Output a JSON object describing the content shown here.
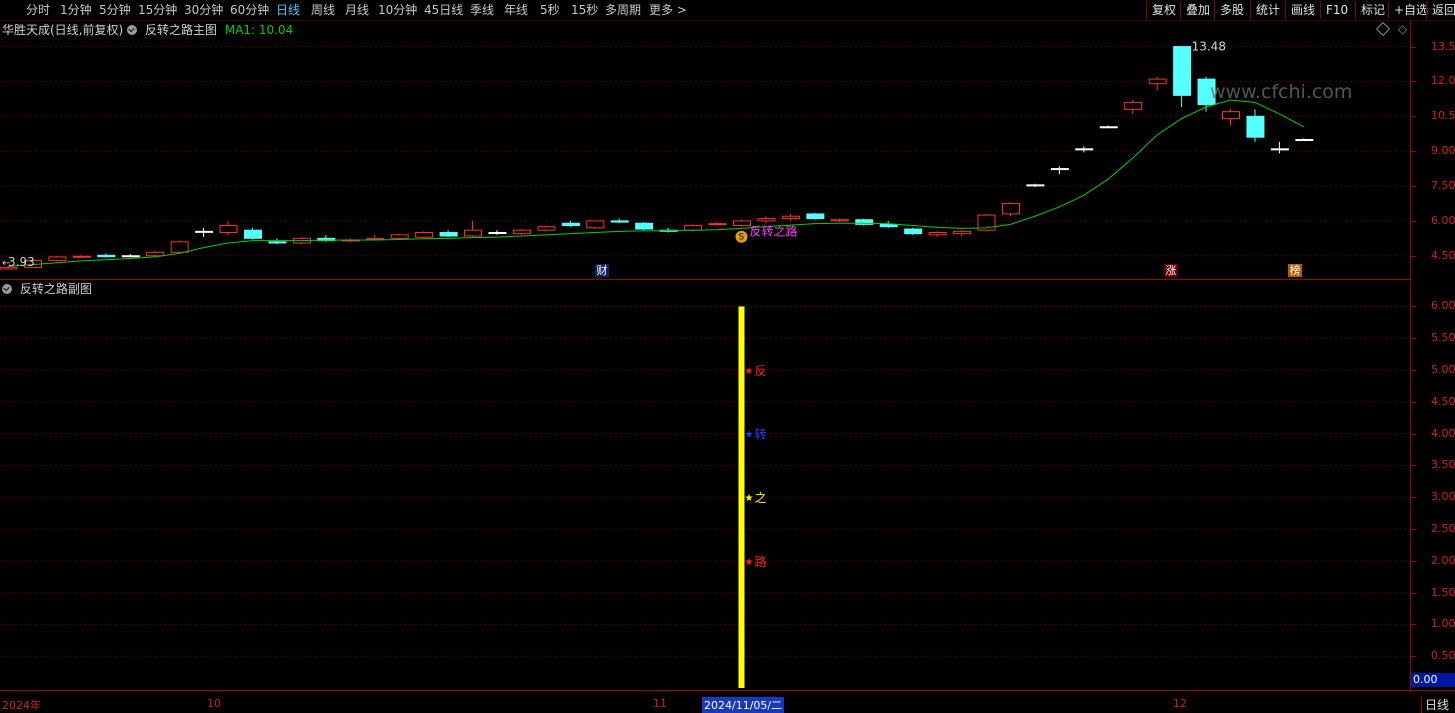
{
  "toolbar": {
    "periods": [
      "分时",
      "1分钟",
      "5分钟",
      "15分钟",
      "30分钟",
      "60分钟",
      "日线",
      "周线",
      "月线",
      "10分钟",
      "45日线",
      "季线",
      "年线",
      "5秒",
      "15秒",
      "多周期",
      "更多 >"
    ],
    "active_period": "日线",
    "tools": [
      "复权",
      "叠加",
      "多股",
      "统计",
      "画线",
      "F10",
      "标记",
      "+自选",
      "返回"
    ]
  },
  "main_chart": {
    "stock_title": "华胜天成(日线,前复权)",
    "indicator_name": "反转之路主图",
    "ma_label": "MA1: 10.04",
    "high_label": "13.48",
    "low_label": "3.93",
    "signal_label": "反转之路",
    "signal_marker": "S",
    "watermark": "www.cfchi.com",
    "y_ticks": [
      "13.50",
      "12.00",
      "10.50",
      "9.00",
      "7.50",
      "6.00",
      "4.50"
    ],
    "event_badges": [
      "财",
      "涨",
      "榜"
    ]
  },
  "sub_chart": {
    "indicator_name": "反转之路副图",
    "y_ticks": [
      "6.00",
      "5.50",
      "5.00",
      "4.50",
      "4.00",
      "3.50",
      "3.00",
      "2.50",
      "2.00",
      "1.50",
      "1.00",
      "0.50"
    ],
    "stars": [
      {
        "char": "反",
        "color": "#ff2020"
      },
      {
        "char": "转",
        "color": "#2040ff"
      },
      {
        "char": "之",
        "color": "#ffff00"
      },
      {
        "char": "路",
        "color": "#ff2020"
      }
    ],
    "readout": "0.00"
  },
  "x_axis": {
    "labels": [
      "2024年",
      "10",
      "11",
      "2024/11/05/二",
      "12"
    ],
    "period_button": "日线"
  },
  "colors": {
    "up": "#ff3030",
    "down": "#54ffff",
    "ma": "#00d000",
    "grid": "#5a0000",
    "axis": "#a00000",
    "bar": "#ffff00"
  },
  "chart_data": {
    "type": "candlestick",
    "ma_series": "MA1",
    "candles": [
      {
        "o": 3.93,
        "h": 4.05,
        "l": 3.93,
        "c": 4.0
      },
      {
        "o": 4.0,
        "h": 4.35,
        "l": 3.98,
        "c": 4.3
      },
      {
        "o": 4.3,
        "h": 4.5,
        "l": 4.25,
        "c": 4.45
      },
      {
        "o": 4.45,
        "h": 4.52,
        "l": 4.4,
        "c": 4.48
      },
      {
        "o": 4.52,
        "h": 4.6,
        "l": 4.42,
        "c": 4.46
      },
      {
        "o": 4.48,
        "h": 4.58,
        "l": 4.45,
        "c": 4.5
      },
      {
        "o": 4.5,
        "h": 4.7,
        "l": 4.48,
        "c": 4.65
      },
      {
        "o": 4.65,
        "h": 5.15,
        "l": 4.62,
        "c": 5.1
      },
      {
        "o": 5.55,
        "h": 5.7,
        "l": 5.3,
        "c": 5.55
      },
      {
        "o": 5.5,
        "h": 6.0,
        "l": 5.4,
        "c": 5.8
      },
      {
        "o": 5.6,
        "h": 5.7,
        "l": 5.2,
        "c": 5.25
      },
      {
        "o": 5.1,
        "h": 5.25,
        "l": 5.0,
        "c": 5.05
      },
      {
        "o": 5.05,
        "h": 5.3,
        "l": 5.0,
        "c": 5.25
      },
      {
        "o": 5.25,
        "h": 5.4,
        "l": 5.1,
        "c": 5.15
      },
      {
        "o": 5.15,
        "h": 5.25,
        "l": 5.08,
        "c": 5.18
      },
      {
        "o": 5.2,
        "h": 5.4,
        "l": 5.15,
        "c": 5.25
      },
      {
        "o": 5.25,
        "h": 5.45,
        "l": 5.2,
        "c": 5.4
      },
      {
        "o": 5.3,
        "h": 5.55,
        "l": 5.25,
        "c": 5.5
      },
      {
        "o": 5.5,
        "h": 5.6,
        "l": 5.3,
        "c": 5.35
      },
      {
        "o": 5.35,
        "h": 6.0,
        "l": 5.3,
        "c": 5.6
      },
      {
        "o": 5.5,
        "h": 5.6,
        "l": 5.4,
        "c": 5.5
      },
      {
        "o": 5.45,
        "h": 5.65,
        "l": 5.4,
        "c": 5.6
      },
      {
        "o": 5.6,
        "h": 5.8,
        "l": 5.55,
        "c": 5.75
      },
      {
        "o": 5.9,
        "h": 6.0,
        "l": 5.75,
        "c": 5.8
      },
      {
        "o": 5.7,
        "h": 6.0,
        "l": 5.65,
        "c": 6.0
      },
      {
        "o": 6.0,
        "h": 6.1,
        "l": 5.9,
        "c": 5.95
      },
      {
        "o": 5.9,
        "h": 5.95,
        "l": 5.6,
        "c": 5.65
      },
      {
        "o": 5.6,
        "h": 5.7,
        "l": 5.5,
        "c": 5.55
      },
      {
        "o": 5.6,
        "h": 5.85,
        "l": 5.55,
        "c": 5.8
      },
      {
        "o": 5.85,
        "h": 5.95,
        "l": 5.8,
        "c": 5.88
      },
      {
        "o": 5.8,
        "h": 6.05,
        "l": 5.75,
        "c": 6.0
      },
      {
        "o": 6.0,
        "h": 6.2,
        "l": 5.9,
        "c": 6.1
      },
      {
        "o": 6.1,
        "h": 6.3,
        "l": 6.0,
        "c": 6.2
      },
      {
        "o": 6.3,
        "h": 6.35,
        "l": 6.05,
        "c": 6.1
      },
      {
        "o": 6.0,
        "h": 6.1,
        "l": 5.95,
        "c": 6.05
      },
      {
        "o": 6.05,
        "h": 6.1,
        "l": 5.8,
        "c": 5.85
      },
      {
        "o": 5.85,
        "h": 6.0,
        "l": 5.7,
        "c": 5.75
      },
      {
        "o": 5.65,
        "h": 5.7,
        "l": 5.4,
        "c": 5.45
      },
      {
        "o": 5.4,
        "h": 5.55,
        "l": 5.3,
        "c": 5.5
      },
      {
        "o": 5.45,
        "h": 5.6,
        "l": 5.35,
        "c": 5.55
      },
      {
        "o": 5.6,
        "h": 6.3,
        "l": 5.55,
        "c": 6.25
      },
      {
        "o": 6.3,
        "h": 6.8,
        "l": 6.2,
        "c": 6.75
      },
      {
        "o": 7.55,
        "h": 7.6,
        "l": 7.45,
        "c": 7.55
      },
      {
        "o": 8.25,
        "h": 8.35,
        "l": 8.0,
        "c": 8.25
      },
      {
        "o": 9.1,
        "h": 9.2,
        "l": 8.95,
        "c": 9.1
      },
      {
        "o": 10.05,
        "h": 10.1,
        "l": 10.0,
        "c": 10.05
      },
      {
        "o": 10.8,
        "h": 11.2,
        "l": 10.6,
        "c": 11.1
      },
      {
        "o": 11.9,
        "h": 12.2,
        "l": 11.6,
        "c": 12.1
      },
      {
        "o": 13.5,
        "h": 13.5,
        "l": 10.9,
        "c": 11.4
      },
      {
        "o": 12.1,
        "h": 12.2,
        "l": 10.7,
        "c": 11.0
      },
      {
        "o": 10.4,
        "h": 10.8,
        "l": 10.1,
        "c": 10.7
      },
      {
        "o": 10.5,
        "h": 10.8,
        "l": 9.4,
        "c": 9.6
      },
      {
        "o": 9.1,
        "h": 9.4,
        "l": 8.9,
        "c": 9.1
      },
      {
        "o": 9.5,
        "h": 9.55,
        "l": 9.45,
        "c": 9.5
      }
    ],
    "ma": [
      4.05,
      4.12,
      4.2,
      4.28,
      4.33,
      4.38,
      4.45,
      4.6,
      4.85,
      5.05,
      5.15,
      5.15,
      5.15,
      5.17,
      5.17,
      5.18,
      5.2,
      5.23,
      5.25,
      5.28,
      5.3,
      5.35,
      5.4,
      5.45,
      5.5,
      5.55,
      5.57,
      5.58,
      5.6,
      5.62,
      5.68,
      5.75,
      5.82,
      5.88,
      5.9,
      5.9,
      5.88,
      5.8,
      5.72,
      5.68,
      5.7,
      5.85,
      6.2,
      6.6,
      7.1,
      7.8,
      8.7,
      9.7,
      10.4,
      10.9,
      11.2,
      11.1,
      10.6,
      10.04
    ],
    "signal_index": 30,
    "sub_bar": {
      "index": 30,
      "y0": 0.0,
      "y1": 6.0
    },
    "sub_stars_y": [
      5.0,
      4.0,
      3.0,
      2.0
    ],
    "main_ylim": [
      3.5,
      14.6
    ],
    "sub_ylim": [
      0.0,
      6.4
    ]
  }
}
